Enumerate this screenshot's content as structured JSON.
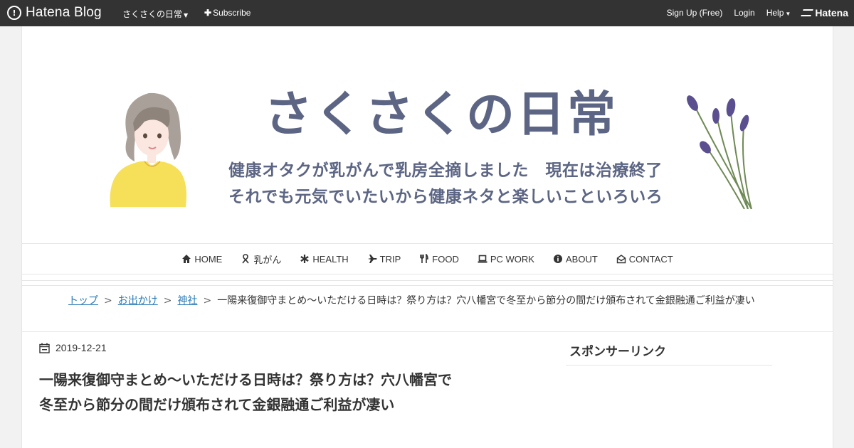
{
  "topbar": {
    "logo_text": "Hatena Blog",
    "blog_name": "さくさくの日常",
    "subscribe_label": "Subscribe",
    "signup_label": "Sign Up (Free)",
    "login_label": "Login",
    "help_label": "Help",
    "brand_label": "Hatena"
  },
  "header": {
    "title": "さくさくの日常",
    "subtitle_line1": "健康オタクが乳がんで乳房全摘しました　現在は治療終了",
    "subtitle_line2": "それでも元気でいたいから健康ネタと楽しいこといろいろ"
  },
  "nav": {
    "items": [
      {
        "label": "HOME",
        "icon": "home-icon"
      },
      {
        "label": "乳がん",
        "icon": "ribbon-icon"
      },
      {
        "label": "HEALTH",
        "icon": "asterisk-icon"
      },
      {
        "label": "TRIP",
        "icon": "plane-icon"
      },
      {
        "label": "FOOD",
        "icon": "cutlery-icon"
      },
      {
        "label": "PC WORK",
        "icon": "laptop-icon"
      },
      {
        "label": "ABOUT",
        "icon": "info-icon"
      },
      {
        "label": "CONTACT",
        "icon": "envelope-open-icon"
      }
    ]
  },
  "breadcrumb": {
    "items": [
      "トップ",
      "お出かけ",
      "神社"
    ],
    "separator": ">",
    "current": "一陽来復御守まとめ～いただける日時は？祭り方は？穴八幡宮で冬至から節分の間だけ頒布されて金銀融通ご利益が凄い"
  },
  "article": {
    "date": "2019-12-21",
    "title_line1": "一陽来復御守まとめ～いただける日時は？祭り方は？穴八幡宮で",
    "title_line2": "冬至から節分の間だけ頒布されて金銀融通ご利益が凄い"
  },
  "sidebar": {
    "sponsor_title": "スポンサーリンク"
  },
  "colors": {
    "topbar_bg": "#333333",
    "header_text": "#5c6583",
    "link": "#2a7bb6"
  }
}
